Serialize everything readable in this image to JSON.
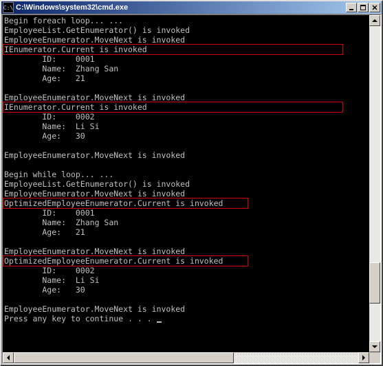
{
  "title": "C:\\Windows\\system32\\cmd.exe",
  "console": {
    "line_begin_foreach": "Begin foreach loop... ...",
    "line_getenum": "EmployeeList.GetEnumerator() is invoked",
    "line_movenext": "EmployeeEnumerator.MoveNext is invoked",
    "line_ienum_current": "IEnumerator.Current is invoked",
    "emp1": {
      "id_label": "        ID:",
      "id_value": "0001",
      "name_label": "        Name:",
      "name_value": "Zhang San",
      "age_label": "        Age:",
      "age_value": "21"
    },
    "emp2": {
      "id_label": "        ID:",
      "id_value": "0002",
      "name_label": "        Name:",
      "name_value": "Li Si",
      "age_label": "        Age:",
      "age_value": "30"
    },
    "line_begin_while": "Begin while loop... ...",
    "line_opt_current": "OptimizedEmployeeEnumerator.Current is invoked",
    "line_press": "Press any key to continue . . . "
  },
  "icons": {
    "cmd": "C:\\",
    "minimize": "minimize-icon",
    "maximize": "maximize-icon",
    "close": "close-icon"
  }
}
